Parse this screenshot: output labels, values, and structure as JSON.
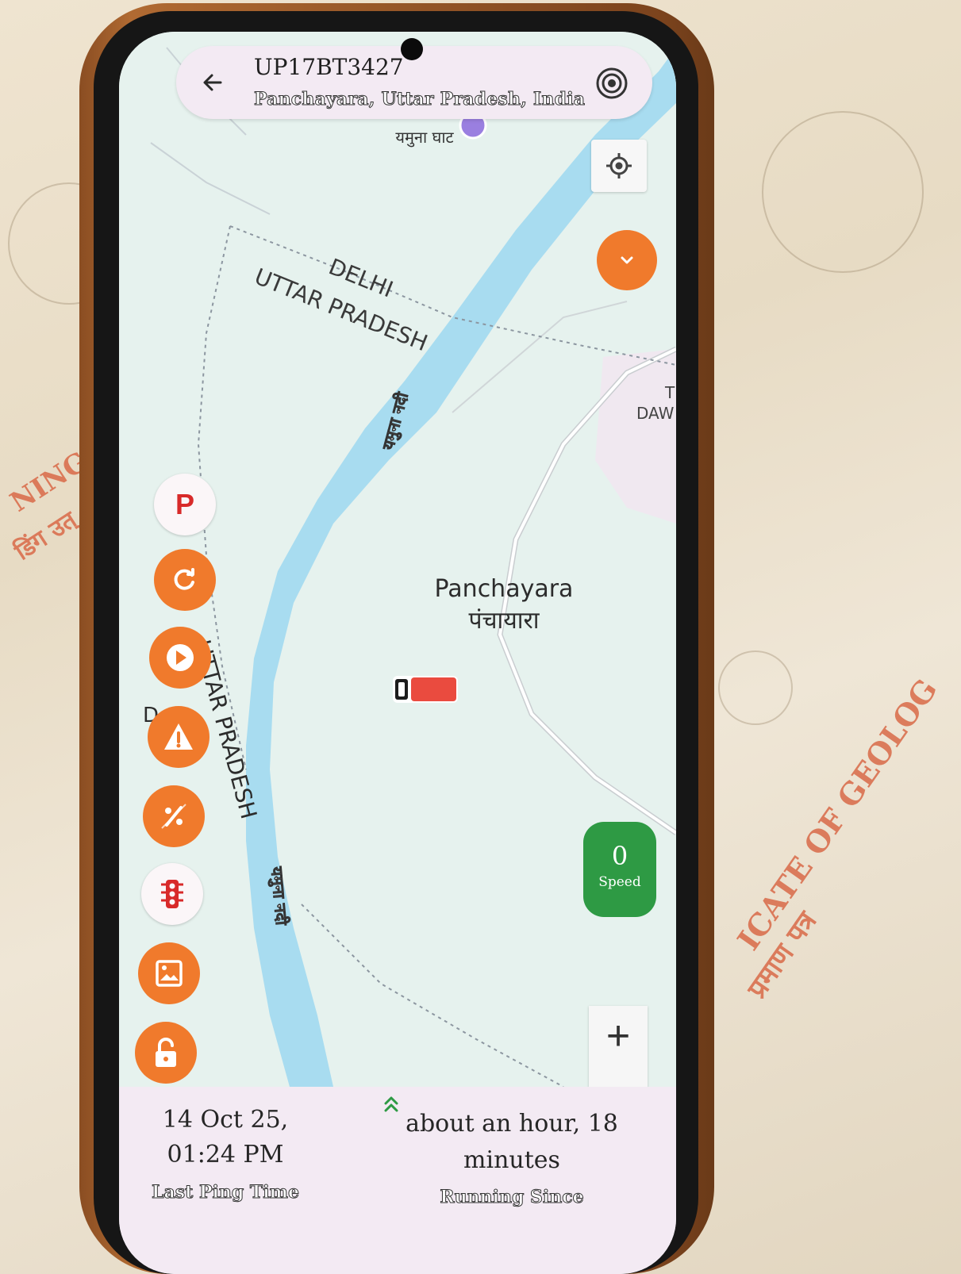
{
  "header": {
    "vehicle_id": "UP17BT3427",
    "location": "Panchayara, Uttar Pradesh, India"
  },
  "map": {
    "labels": {
      "ghat": "यमुना घाट",
      "state_line1": "DELHI",
      "state_line2": "UTTAR PRADESH",
      "river1": "यमुना नदी",
      "town_en": "Panchayara",
      "town_hi": "पंचायारा",
      "state_vertical": "UTTAR PRADESH",
      "d_letter": "D",
      "river2": "यमुना नदी",
      "edge_t": "T",
      "edge_daw": "DAW"
    }
  },
  "side_actions": {
    "parking_letter": "P"
  },
  "speed": {
    "value": "0",
    "label": "Speed"
  },
  "zoom": {
    "plus": "+"
  },
  "footer": {
    "last_ping_value": "14 Oct 25, 01:24 PM",
    "last_ping_label": "Last Ping Time",
    "running_since_value": "about an hour, 18 minutes",
    "running_since_label": "Running Since"
  },
  "background": {
    "left_text_1": "NING UT",
    "left_text_2": "डिंग उत्",
    "right_text_1": "ICATE OF GEOLOG",
    "right_text_2": "प्रमाण पत्र"
  },
  "colors": {
    "accent_orange": "#f07a2c",
    "speed_green": "#2e9a44",
    "river_blue": "#a8dcf0",
    "map_bg": "#e6f2ee",
    "panel_bg": "#f3eaf3"
  }
}
